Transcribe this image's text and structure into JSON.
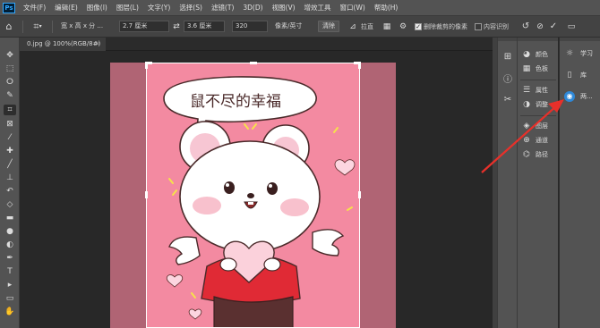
{
  "app": {
    "logo": "Ps"
  },
  "menubar": {
    "items": [
      "文件(F)",
      "编辑(E)",
      "图像(I)",
      "图层(L)",
      "文字(Y)",
      "选择(S)",
      "滤镜(T)",
      "3D(D)",
      "视图(V)",
      "增效工具",
      "窗口(W)",
      "帮助(H)"
    ]
  },
  "options": {
    "ratio_select": "宽 x 高 x 分 ...",
    "width_value": "2.7 厘米",
    "swap_icon": "swap-arrows",
    "height_value": "3.6 厘米",
    "resolution_value": "320",
    "unit_select": "像素/英寸",
    "clear_label": "清除",
    "straighten_label": "拉直",
    "delete_cropped_label": "删除裁剪的像素",
    "delete_cropped_checked": true,
    "content_aware_label": "内容识别",
    "content_aware_checked": false
  },
  "document": {
    "tab_title": "0.jpg @ 100%(RGB/8#)",
    "close_glyph": "×"
  },
  "poster": {
    "caption": "鼠不尽的幸福"
  },
  "panels": {
    "group1": [
      {
        "icon": "color-icon",
        "label": "颜色"
      },
      {
        "icon": "swatches-icon",
        "label": "色板"
      }
    ],
    "group2": [
      {
        "icon": "properties-icon",
        "label": "属性"
      },
      {
        "icon": "adjustments-icon",
        "label": "调整"
      }
    ],
    "group3": [
      {
        "icon": "layers-icon",
        "label": "图层"
      },
      {
        "icon": "channels-icon",
        "label": "通道"
      },
      {
        "icon": "paths-icon",
        "label": "路径"
      }
    ],
    "learn": [
      {
        "icon": "lightbulb-icon",
        "label": "学习"
      },
      {
        "icon": "library-icon",
        "label": "库"
      },
      {
        "icon": "navigator-icon",
        "label": "两..."
      }
    ]
  },
  "colors": {
    "accent": "#31a8ff",
    "annotation_arrow": "#e8302a",
    "poster_bg": "#f38aa1"
  }
}
